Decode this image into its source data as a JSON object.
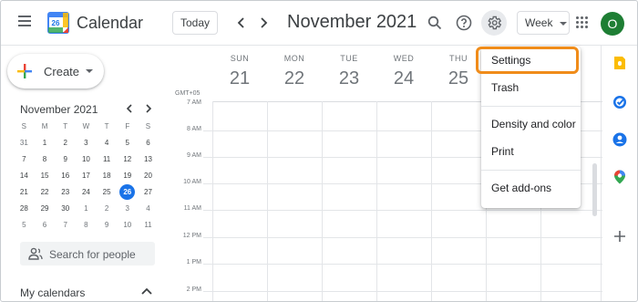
{
  "header": {
    "app_title": "Calendar",
    "logo_day": "26",
    "today_label": "Today",
    "month_title": "November 2021",
    "view_label": "Week",
    "avatar_initial": "O"
  },
  "sidebar": {
    "create_label": "Create",
    "mini_calendar": {
      "title": "November 2021",
      "days_of_week": [
        "S",
        "M",
        "T",
        "W",
        "T",
        "F",
        "S"
      ],
      "weeks": [
        [
          "31",
          "1",
          "2",
          "3",
          "4",
          "5",
          "6"
        ],
        [
          "7",
          "8",
          "9",
          "10",
          "11",
          "12",
          "13"
        ],
        [
          "14",
          "15",
          "16",
          "17",
          "18",
          "19",
          "20"
        ],
        [
          "21",
          "22",
          "23",
          "24",
          "25",
          "26",
          "27"
        ],
        [
          "28",
          "29",
          "30",
          "1",
          "2",
          "3",
          "4"
        ],
        [
          "5",
          "6",
          "7",
          "8",
          "9",
          "10",
          "11"
        ]
      ],
      "today": "26"
    },
    "search_people_placeholder": "Search for people",
    "my_calendars_label": "My calendars"
  },
  "week": {
    "timezone_label": "GMT+05",
    "days": [
      {
        "dow": "SUN",
        "date": "21"
      },
      {
        "dow": "MON",
        "date": "22"
      },
      {
        "dow": "TUE",
        "date": "23"
      },
      {
        "dow": "WED",
        "date": "24"
      },
      {
        "dow": "THU",
        "date": "25"
      }
    ],
    "partial_top_time_label": "7 AM",
    "time_labels": [
      "8 AM",
      "9 AM",
      "10 AM",
      "11 AM",
      "12 PM",
      "1 PM",
      "2 PM"
    ]
  },
  "settings_menu": {
    "items": [
      "Settings",
      "Trash",
      "Density and color",
      "Print",
      "Get add-ons"
    ],
    "highlighted": "Settings"
  },
  "colors": {
    "accent": "#1a73e8",
    "highlight_border": "#f08c1a",
    "avatar_bg": "#1e7e34"
  },
  "icons": [
    "menu-icon",
    "calendar-logo-icon",
    "chevron-left-icon",
    "chevron-right-icon",
    "search-icon",
    "help-icon",
    "gear-icon",
    "apps-icon",
    "plus-icon",
    "people-icon",
    "keep-icon",
    "tasks-icon",
    "contacts-icon",
    "maps-icon",
    "add-icon"
  ]
}
